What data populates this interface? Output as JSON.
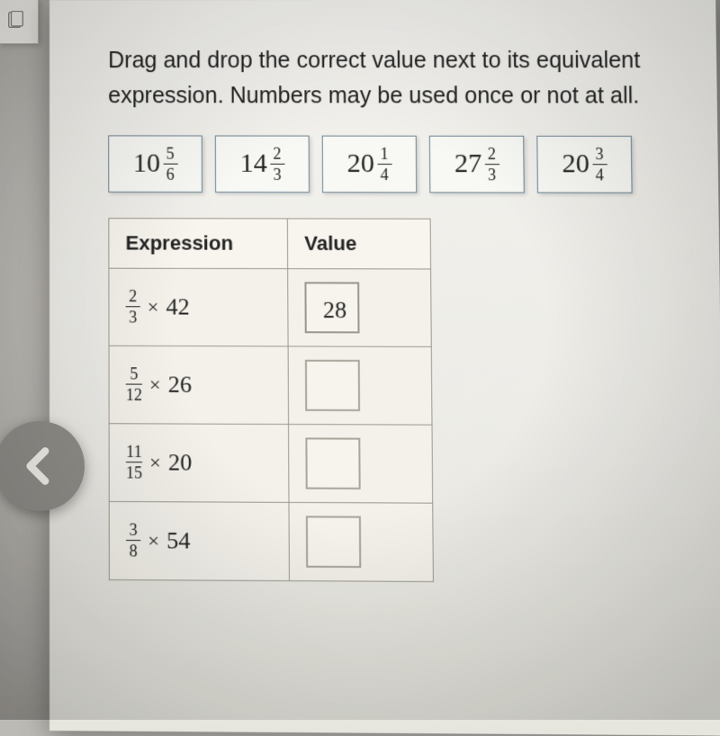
{
  "instructions": {
    "line1": "Drag and drop the correct value next to its equivalent",
    "line2": "expression. Numbers may be used once or not at all."
  },
  "tiles": [
    {
      "whole": "10",
      "num": "5",
      "den": "6"
    },
    {
      "whole": "14",
      "num": "2",
      "den": "3"
    },
    {
      "whole": "20",
      "num": "1",
      "den": "4"
    },
    {
      "whole": "27",
      "num": "2",
      "den": "3"
    },
    {
      "whole": "20",
      "num": "3",
      "den": "4"
    }
  ],
  "table": {
    "headers": {
      "expr": "Expression",
      "val": "Value"
    },
    "rows": [
      {
        "num": "2",
        "den": "3",
        "mult": "42",
        "value": "28"
      },
      {
        "num": "5",
        "den": "12",
        "mult": "26",
        "value": ""
      },
      {
        "num": "11",
        "den": "15",
        "mult": "20",
        "value": ""
      },
      {
        "num": "3",
        "den": "8",
        "mult": "54",
        "value": ""
      }
    ]
  },
  "glyphs": {
    "times": "×"
  },
  "chart_data": {
    "type": "table",
    "title": "Fraction multiplication matching worksheet",
    "draggable_values": [
      "10 5/6",
      "14 2/3",
      "20 1/4",
      "27 2/3",
      "20 3/4"
    ],
    "rows": [
      {
        "expression": "2/3 × 42",
        "value": "28"
      },
      {
        "expression": "5/12 × 26",
        "value": null
      },
      {
        "expression": "11/15 × 20",
        "value": null
      },
      {
        "expression": "3/8 × 54",
        "value": null
      }
    ]
  }
}
